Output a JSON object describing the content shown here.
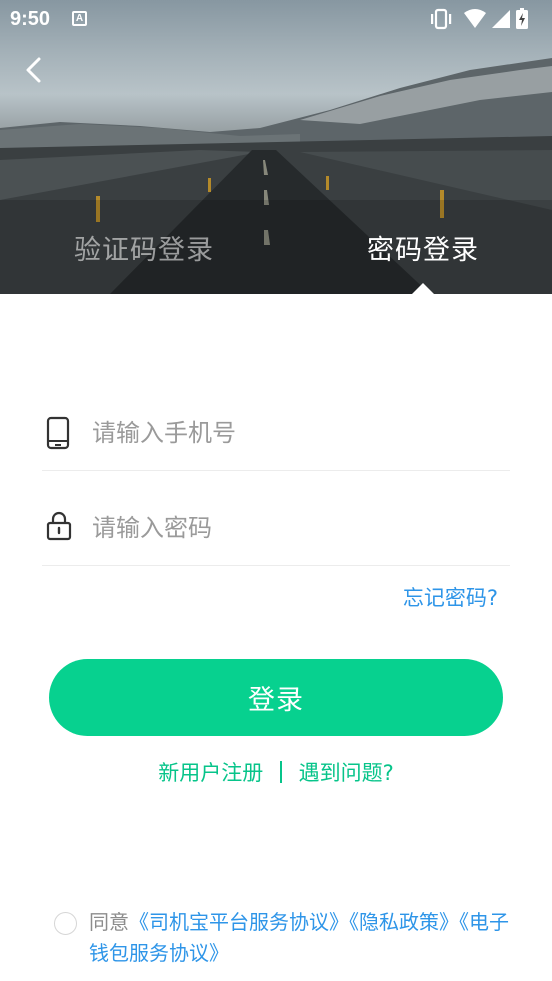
{
  "status_bar": {
    "time": "9:50",
    "notification_icon_letter": "A",
    "icons": [
      "vibrate-icon",
      "wifi-icon",
      "signal-icon",
      "battery-icon"
    ]
  },
  "header": {
    "back_icon": "chevron-left-icon",
    "tabs": [
      {
        "label": "验证码登录",
        "active": false
      },
      {
        "label": "密码登录",
        "active": true
      }
    ]
  },
  "form": {
    "phone": {
      "icon": "phone-icon",
      "placeholder": "请输入手机号",
      "value": ""
    },
    "password": {
      "icon": "lock-icon",
      "placeholder": "请输入密码",
      "value": ""
    },
    "forgot_label": "忘记密码?",
    "login_label": "登录"
  },
  "links": {
    "register_label": "新用户注册",
    "help_label": "遇到问题?"
  },
  "agreement": {
    "prefix": "同意",
    "service_label": "《司机宝平台服务协议》",
    "privacy_label": "《隐私政策》",
    "wallet_label": "《电子钱包服务协议》",
    "checked": false
  },
  "colors": {
    "primary_green": "#07d18f",
    "link_blue": "#2e95e8",
    "placeholder_gray": "#9a9a9a"
  }
}
